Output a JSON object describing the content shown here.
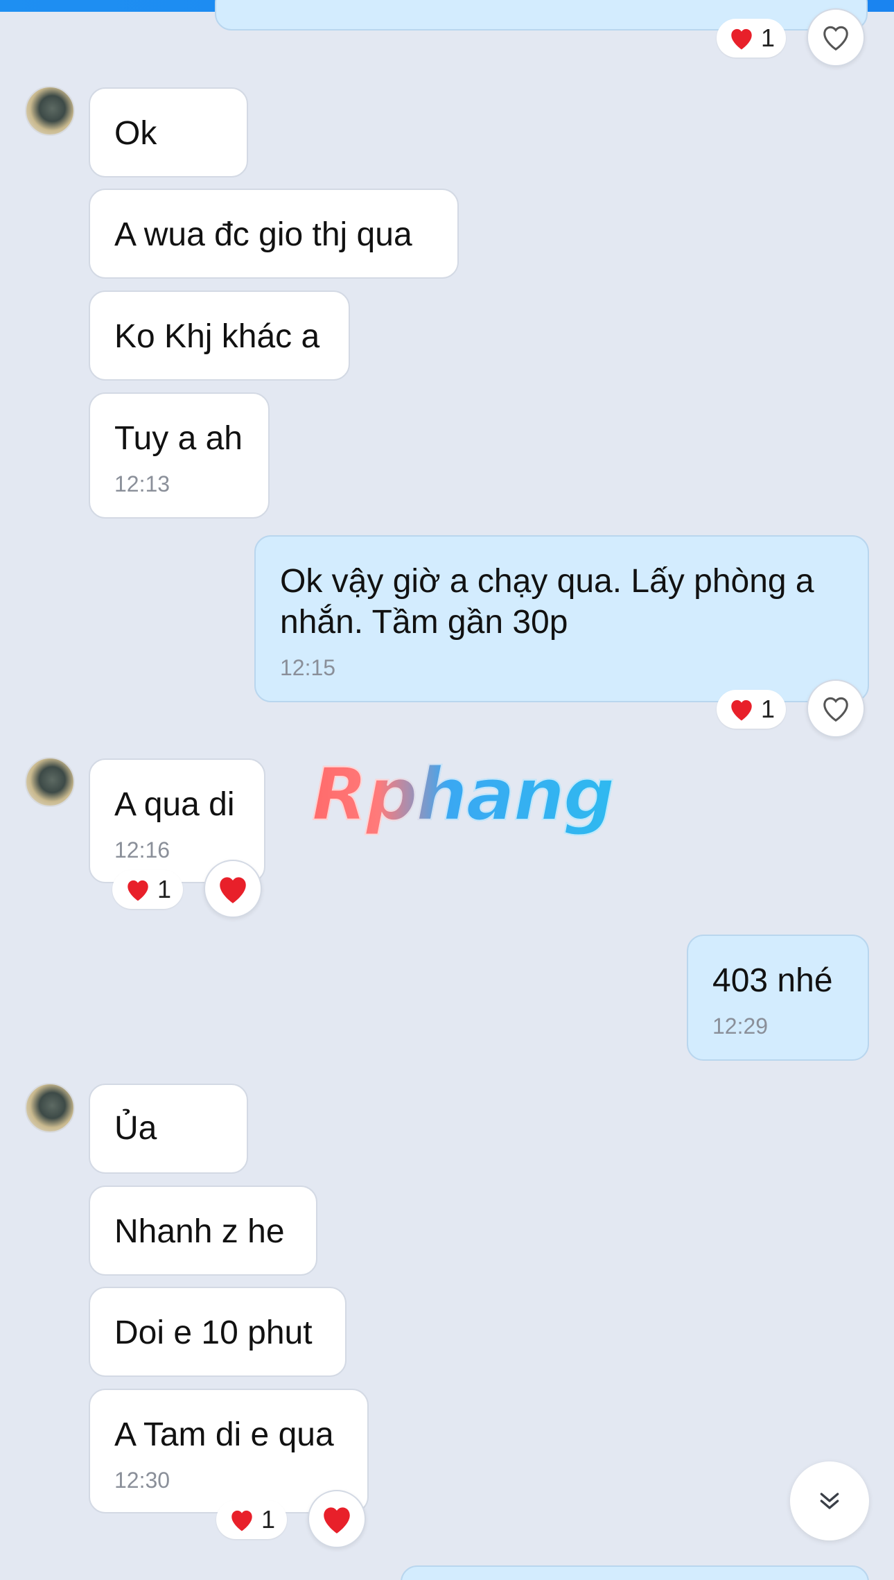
{
  "reaction_emoji": "heart",
  "colors": {
    "incoming_bubble": "#ffffff",
    "outgoing_bubble": "#d3ecfe",
    "background": "#e3e8f2",
    "heart": "#e8202a",
    "top_bar": "#1e8ff2"
  },
  "messages": [
    {
      "text": "Ok"
    },
    {
      "text": "A wua đc gio thj qua"
    },
    {
      "text": "Ko Khj khác a"
    },
    {
      "text": "Tuy a ah",
      "time": "12:13"
    },
    {
      "text_line1": "Ok vậy giờ a chạy qua. Lấy phòng a",
      "text_line2": "nhắn. Tầm gần 30p",
      "time": "12:15"
    },
    {
      "text": "A qua di",
      "time": "12:16"
    },
    {
      "text": "403 nhé",
      "time": "12:29"
    },
    {
      "text": "Ủa"
    },
    {
      "text": "Nhanh z he"
    },
    {
      "text": "Doi e 10 phut"
    },
    {
      "text": "A Tam di e qua",
      "time": "12:30"
    }
  ],
  "reactions": [
    {
      "count": "1"
    },
    {
      "count": "1"
    },
    {
      "count": "1"
    },
    {
      "count": "1"
    }
  ],
  "watermark": "Rphang",
  "scroll_button_icon": "double-chevron-down-icon"
}
